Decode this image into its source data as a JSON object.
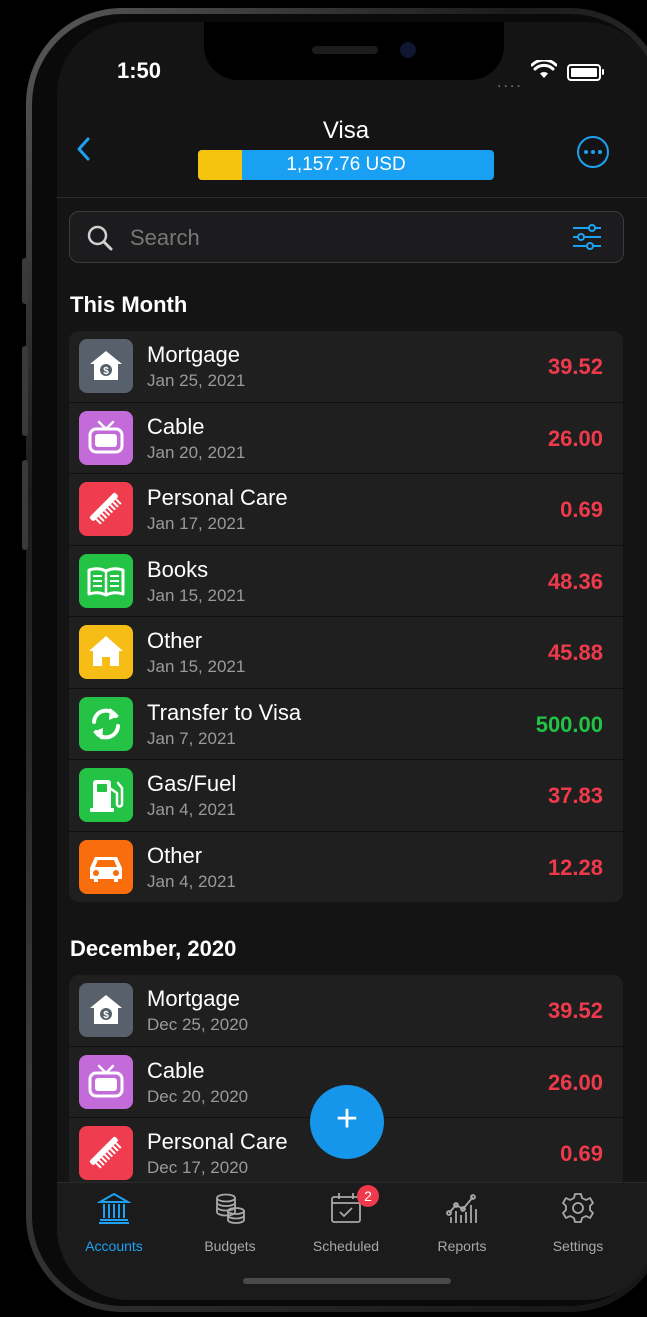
{
  "status_bar": {
    "time": "1:50",
    "signal": "...."
  },
  "header": {
    "title": "Visa",
    "balance": "1,157.76 USD",
    "balance_used_fraction": 0.15,
    "colors": {
      "used": "#f5c40f",
      "available": "#19a0f2",
      "accent": "#1da1f2"
    }
  },
  "search": {
    "placeholder": "Search"
  },
  "sections": [
    {
      "title": "This Month",
      "items": [
        {
          "name": "Mortgage",
          "date": "Jan 25, 2021",
          "amount": "39.52",
          "type": "expense",
          "icon": "house-dollar-icon",
          "color": "#58616b"
        },
        {
          "name": "Cable",
          "date": "Jan 20, 2021",
          "amount": "26.00",
          "type": "expense",
          "icon": "tv-icon",
          "color": "#c26bd9"
        },
        {
          "name": "Personal Care",
          "date": "Jan 17, 2021",
          "amount": "0.69",
          "type": "expense",
          "icon": "comb-icon",
          "color": "#ef3c4e"
        },
        {
          "name": "Books",
          "date": "Jan 15, 2021",
          "amount": "48.36",
          "type": "expense",
          "icon": "book-icon",
          "color": "#25c345"
        },
        {
          "name": "Other",
          "date": "Jan 15, 2021",
          "amount": "45.88",
          "type": "expense",
          "icon": "home-icon",
          "color": "#f6bd16"
        },
        {
          "name": "Transfer to Visa",
          "date": "Jan 7, 2021",
          "amount": "500.00",
          "type": "income",
          "icon": "transfer-icon",
          "color": "#25c345"
        },
        {
          "name": "Gas/Fuel",
          "date": "Jan 4, 2021",
          "amount": "37.83",
          "type": "expense",
          "icon": "fuel-pump-icon",
          "color": "#25c345"
        },
        {
          "name": "Other",
          "date": "Jan 4, 2021",
          "amount": "12.28",
          "type": "expense",
          "icon": "car-icon",
          "color": "#f96d0c"
        }
      ]
    },
    {
      "title": "December, 2020",
      "items": [
        {
          "name": "Mortgage",
          "date": "Dec 25, 2020",
          "amount": "39.52",
          "type": "expense",
          "icon": "house-dollar-icon",
          "color": "#58616b"
        },
        {
          "name": "Cable",
          "date": "Dec 20, 2020",
          "amount": "26.00",
          "type": "expense",
          "icon": "tv-icon",
          "color": "#c26bd9"
        },
        {
          "name": "Personal Care",
          "date": "Dec 17, 2020",
          "amount": "0.69",
          "type": "expense",
          "icon": "comb-icon",
          "color": "#ef3c4e"
        }
      ]
    }
  ],
  "fab": {
    "label": "+"
  },
  "tabs": [
    {
      "label": "Accounts",
      "icon": "bank-icon",
      "active": true
    },
    {
      "label": "Budgets",
      "icon": "coins-icon",
      "active": false
    },
    {
      "label": "Scheduled",
      "icon": "calendar-check-icon",
      "active": false,
      "badge": "2"
    },
    {
      "label": "Reports",
      "icon": "chart-icon",
      "active": false
    },
    {
      "label": "Settings",
      "icon": "gear-icon",
      "active": false
    }
  ]
}
